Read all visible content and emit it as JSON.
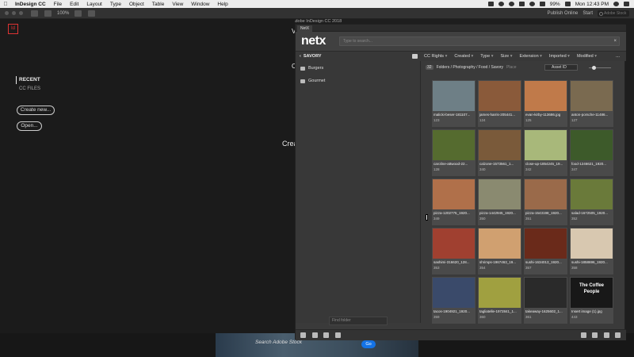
{
  "menubar": {
    "app_name": "InDesign CC",
    "items": [
      "File",
      "Edit",
      "Layout",
      "Type",
      "Object",
      "Table",
      "View",
      "Window",
      "Help"
    ],
    "battery": "99%",
    "clock": "Mon 12:43 PM"
  },
  "controlbar": {
    "zoom": "100%",
    "publish": "Publish Online",
    "workspace": "Start",
    "stock_search": "Adobe Stock"
  },
  "window_title": "Adobe InDesign CC 2018",
  "start": {
    "recent": "RECENT",
    "cc_files": "CC FILES",
    "create_new": "Create new...",
    "open": "Open...",
    "partial_text": "Crea",
    "partial_v": "V",
    "partial_c": "C"
  },
  "stock": {
    "search_placeholder": "Search Adobe Stock",
    "go": "Go"
  },
  "panel": {
    "tab": "NetX",
    "logo": "netx",
    "search_placeholder": "Type to search...",
    "current_folder": "SAVORY",
    "filters": [
      "CC Rights",
      "Created",
      "Type",
      "Size",
      "Extension",
      "Imported",
      "Modified"
    ],
    "more": "...",
    "folders": [
      "Burgers",
      "Gourmet"
    ],
    "find_folder": "Find folder",
    "count": "32",
    "breadcrumb": "Folders / Photography / Food / Savory",
    "place": "Place",
    "sort": "Asset ID",
    "assets": [
      {
        "name": "malicki-beser-181107...",
        "id": "123",
        "color": "#6e7f86"
      },
      {
        "name": "james-harris-205441...",
        "id": "124",
        "color": "#8a5a3a"
      },
      {
        "name": "evan-kirby-113686.jpg",
        "id": "125",
        "color": "#c07a4a"
      },
      {
        "name": "anton-porsche-11486...",
        "id": "127",
        "color": "#7a6a50"
      },
      {
        "name": "caroline-attwood-22...",
        "id": "128",
        "color": "#556b2f"
      },
      {
        "name": "calzone-1573561_1...",
        "id": "340",
        "color": "#7a5a3a"
      },
      {
        "name": "close-up-1854245_19...",
        "id": "342",
        "color": "#a8b87a"
      },
      {
        "name": "food-1246621_1920...",
        "id": "347",
        "color": "#3d5a2a"
      },
      {
        "name": "pizza-1202775_1920...",
        "id": "349",
        "color": "#b0704a"
      },
      {
        "name": "pizza-1442945_1920...",
        "id": "350",
        "color": "#8a8a70"
      },
      {
        "name": "pizza-1543198_1920...",
        "id": "351",
        "color": "#9a6a4a"
      },
      {
        "name": "salad-1672505_1920...",
        "id": "352",
        "color": "#6a7a3a"
      },
      {
        "name": "sashimi-316620_128...",
        "id": "353",
        "color": "#a04030"
      },
      {
        "name": "shrimps-1967463_19...",
        "id": "354",
        "color": "#d0a070"
      },
      {
        "name": "sushi-1634013_1920...",
        "id": "357",
        "color": "#6a2a1a"
      },
      {
        "name": "sushi-1858696_1920...",
        "id": "358",
        "color": "#d8c8b0"
      },
      {
        "name": "tacos-1904921_1920...",
        "id": "359",
        "color": "#3a4a6a"
      },
      {
        "name": "tagliatelle-1972841_1...",
        "id": "360",
        "color": "#a0a040"
      },
      {
        "name": "takeaway-1625602_1...",
        "id": "361",
        "color": "#2a2a2a"
      },
      {
        "name": "Insert image (1).jpg",
        "id": "443",
        "color": "#181818",
        "text": "The Coffee People"
      }
    ]
  }
}
